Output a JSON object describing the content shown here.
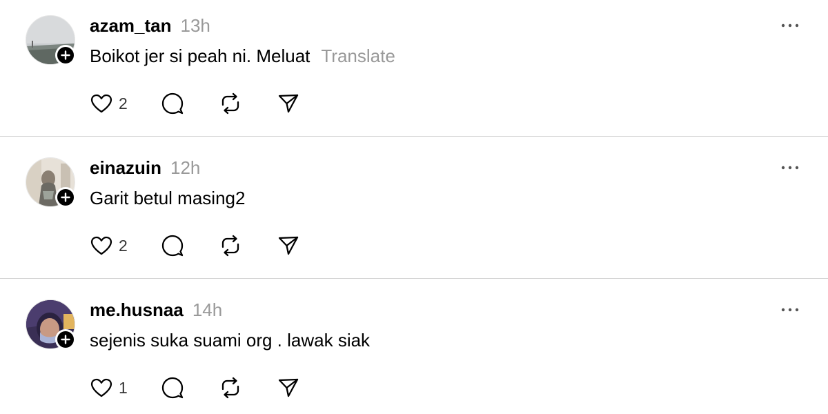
{
  "posts": [
    {
      "username": "azam_tan",
      "time": "13h",
      "text": "Boikot jer si peah ni. Meluat",
      "translate": "Translate",
      "likes": "2"
    },
    {
      "username": "einazuin",
      "time": "12h",
      "text": "Garit betul masing2",
      "translate": "",
      "likes": "2"
    },
    {
      "username": "me.husnaa",
      "time": "14h",
      "text": "sejenis suka suami org . lawak siak",
      "translate": "",
      "likes": "1"
    }
  ],
  "icons": {
    "like": "heart-icon",
    "comment": "comment-icon",
    "repost": "repost-icon",
    "share": "send-icon",
    "more": "more-options-icon",
    "follow": "plus-icon"
  },
  "colors": {
    "text": "#000000",
    "muted": "#999999",
    "divider": "#d0d0d0"
  }
}
